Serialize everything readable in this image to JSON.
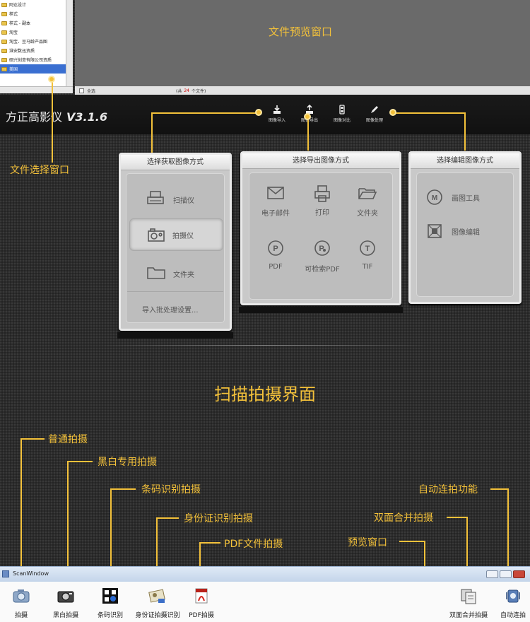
{
  "file_tree": {
    "items": [
      {
        "label": "阿达设计",
        "selected": false
      },
      {
        "label": "样式",
        "selected": false
      },
      {
        "label": "样式 - 副本",
        "selected": false
      },
      {
        "label": "淘宝",
        "selected": false
      },
      {
        "label": "淘宝、豆马龄产品图",
        "selected": false
      },
      {
        "label": "淮安数迅资质",
        "selected": false
      },
      {
        "label": "硕兴创意有限公司资质",
        "selected": false
      },
      {
        "label": "美国",
        "selected": true
      }
    ],
    "label": "文件选择窗口"
  },
  "preview": {
    "label": "文件预览窗口",
    "select_all": "全选",
    "count_prefix": "(共",
    "count": "24",
    "count_suffix": "个文件)"
  },
  "brand": {
    "name": "方正高影仪",
    "version": "V3.1.6"
  },
  "toolbar": [
    {
      "label": "图像导入",
      "icon": "import-icon"
    },
    {
      "label": "图像导出",
      "icon": "export-icon"
    },
    {
      "label": "图像对比",
      "icon": "compare-icon"
    },
    {
      "label": "图像处理",
      "icon": "pen-icon"
    }
  ],
  "panel_acquire": {
    "title": "选择获取图像方式",
    "options": [
      "扫描仪",
      "拍摄仪",
      "文件夹"
    ],
    "batch": "导入批处理设置..."
  },
  "panel_export": {
    "title": "选择导出图像方式",
    "options": [
      "电子邮件",
      "打印",
      "文件夹",
      "PDF",
      "可检索PDF",
      "TIF"
    ]
  },
  "panel_edit": {
    "title": "选择编辑图像方式",
    "options": [
      "画图工具",
      "图像编辑"
    ]
  },
  "section_title": "扫描拍摄界面",
  "annotations": {
    "normal": "普通拍摄",
    "bw": "黑白专用拍摄",
    "barcode": "条码识别拍摄",
    "idcard": "身份证识别拍摄",
    "pdf": "PDF文件拍摄",
    "preview": "预览窗口",
    "duplex": "双面合并拍摄",
    "auto": "自动连拍功能"
  },
  "scan_window": {
    "title": "ScanWindow",
    "tools": [
      "拍摄",
      "黑白拍摄",
      "条码识别",
      "身份证拍摄识别",
      "PDF拍摄",
      "双面合并拍摄",
      "自动连拍"
    ]
  },
  "colors": {
    "accent": "#f3c13a",
    "background": "#2c2c2c",
    "panel": "#c9c9c9"
  }
}
